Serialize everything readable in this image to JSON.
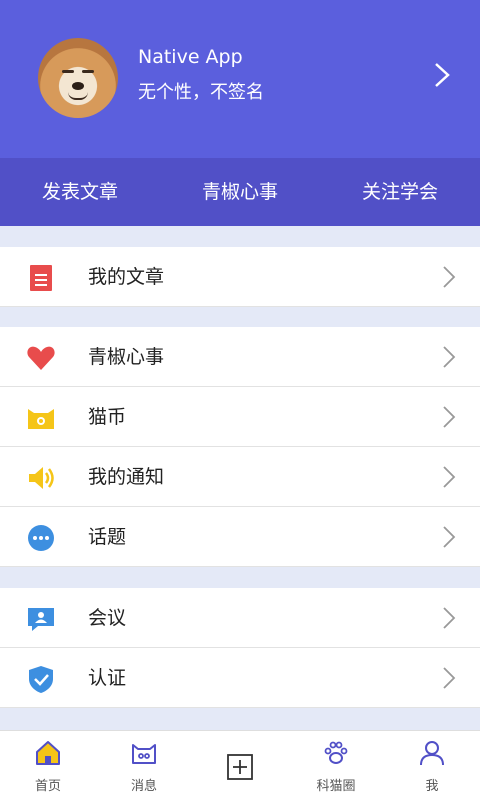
{
  "profile": {
    "name": "Native App",
    "signature": "无个性，不签名"
  },
  "stats": [
    "发表文章",
    "青椒心事",
    "关注学会"
  ],
  "menu": {
    "group1": [
      {
        "label": "我的文章",
        "icon": "document-icon",
        "color": "#e84c4c"
      }
    ],
    "group2": [
      {
        "label": "青椒心事",
        "icon": "heart-icon",
        "color": "#e84c4c"
      },
      {
        "label": "猫币",
        "icon": "cat-coin-icon",
        "color": "#f5c518"
      },
      {
        "label": "我的通知",
        "icon": "speaker-icon",
        "color": "#f5c518"
      },
      {
        "label": "话题",
        "icon": "chat-bubble-icon",
        "color": "#3d8fe0"
      }
    ],
    "group3": [
      {
        "label": "会议",
        "icon": "meeting-icon",
        "color": "#3d8fe0"
      },
      {
        "label": "认证",
        "icon": "shield-check-icon",
        "color": "#3d8fe0"
      }
    ]
  },
  "tabbar": [
    {
      "label": "首页",
      "icon": "home-icon"
    },
    {
      "label": "消息",
      "icon": "message-cat-icon"
    },
    {
      "label": "",
      "icon": "add-icon"
    },
    {
      "label": "科猫圈",
      "icon": "paw-icon"
    },
    {
      "label": "我",
      "icon": "user-icon"
    }
  ],
  "colors": {
    "header": "#5b5fdd",
    "stats_bar": "#5150c7",
    "background": "#e4e9f7"
  }
}
